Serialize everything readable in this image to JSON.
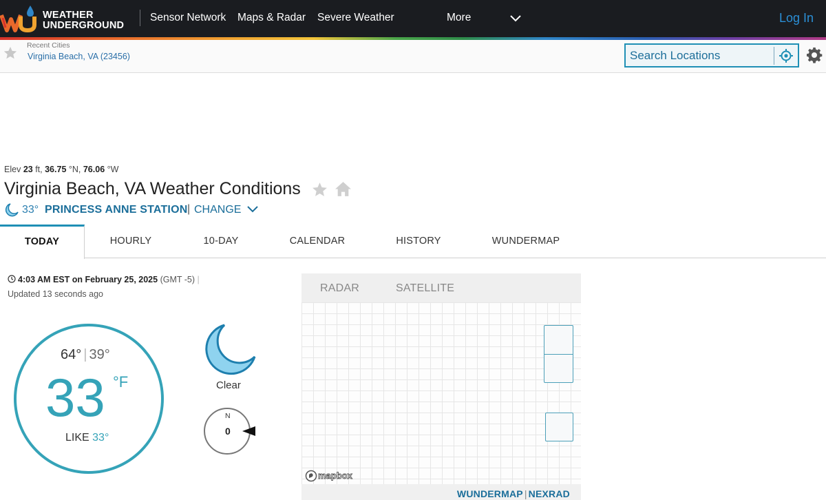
{
  "header": {
    "logo_text_line1": "WEATHER",
    "logo_text_line2": "UNDERGROUND",
    "nav": [
      "Sensor Network",
      "Maps & Radar",
      "Severe Weather",
      "More"
    ],
    "login": "Log In"
  },
  "subbar": {
    "recent_label": "Recent Cities",
    "recent_city": "Virginia Beach, VA (23456)",
    "search_placeholder": "Search Locations"
  },
  "location": {
    "elev_label": "Elev",
    "elev_value": "23",
    "elev_unit": "ft,",
    "lat": "36.75",
    "lat_unit": "°N,",
    "lon": "76.06",
    "lon_unit": "°W",
    "title": "Virginia Beach, VA Weather Conditions",
    "station_temp": "33°",
    "station_name": "PRINCESS ANNE STATION",
    "station_sep": "|",
    "change_label": "CHANGE"
  },
  "tabs": [
    "TODAY",
    "HOURLY",
    "10-DAY",
    "CALENDAR",
    "HISTORY",
    "WUNDERMAP"
  ],
  "current": {
    "time_bold": "4:03 AM EST on February 25, 2025",
    "gmt": "(GMT -5)",
    "gmt_sep": "|",
    "updated": "Updated 13 seconds ago",
    "high": "64°",
    "hilo_sep": "|",
    "low": "39°",
    "temp": "33",
    "unit": "°F",
    "feels_label": "LIKE",
    "feels_value": "33°",
    "condition": "Clear",
    "wind_dir_label": "N",
    "wind_speed": "0"
  },
  "map": {
    "tabs": [
      "RADAR",
      "SATELLITE"
    ],
    "attribution": "mapbox",
    "link_wundermap": "WUNDERMAP",
    "link_sep": "|",
    "link_nexrad": "NEXRAD"
  },
  "colors": {
    "accent": "#35a3b8",
    "link": "#1b6e9a",
    "topbar": "#1a1c20",
    "login": "#2b8fd6"
  }
}
